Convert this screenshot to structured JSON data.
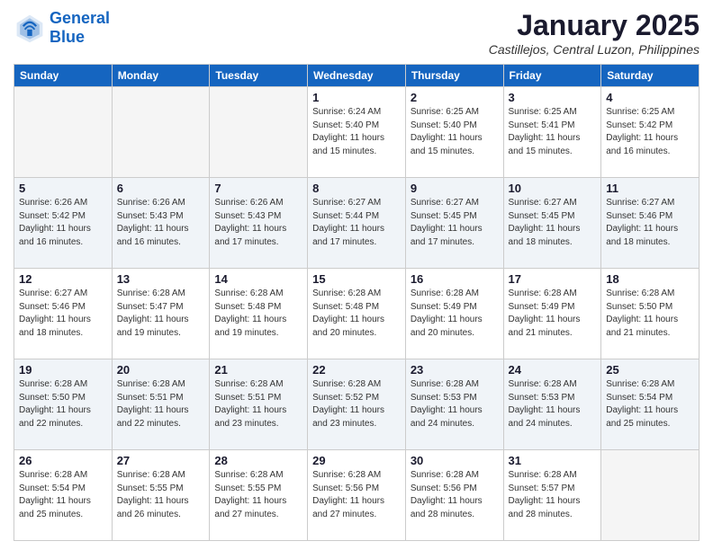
{
  "header": {
    "logo_line1": "General",
    "logo_line2": "Blue",
    "month_title": "January 2025",
    "subtitle": "Castillejos, Central Luzon, Philippines"
  },
  "days_of_week": [
    "Sunday",
    "Monday",
    "Tuesday",
    "Wednesday",
    "Thursday",
    "Friday",
    "Saturday"
  ],
  "weeks": [
    [
      {
        "day": "",
        "info": ""
      },
      {
        "day": "",
        "info": ""
      },
      {
        "day": "",
        "info": ""
      },
      {
        "day": "1",
        "info": "Sunrise: 6:24 AM\nSunset: 5:40 PM\nDaylight: 11 hours\nand 15 minutes."
      },
      {
        "day": "2",
        "info": "Sunrise: 6:25 AM\nSunset: 5:40 PM\nDaylight: 11 hours\nand 15 minutes."
      },
      {
        "day": "3",
        "info": "Sunrise: 6:25 AM\nSunset: 5:41 PM\nDaylight: 11 hours\nand 15 minutes."
      },
      {
        "day": "4",
        "info": "Sunrise: 6:25 AM\nSunset: 5:42 PM\nDaylight: 11 hours\nand 16 minutes."
      }
    ],
    [
      {
        "day": "5",
        "info": "Sunrise: 6:26 AM\nSunset: 5:42 PM\nDaylight: 11 hours\nand 16 minutes."
      },
      {
        "day": "6",
        "info": "Sunrise: 6:26 AM\nSunset: 5:43 PM\nDaylight: 11 hours\nand 16 minutes."
      },
      {
        "day": "7",
        "info": "Sunrise: 6:26 AM\nSunset: 5:43 PM\nDaylight: 11 hours\nand 17 minutes."
      },
      {
        "day": "8",
        "info": "Sunrise: 6:27 AM\nSunset: 5:44 PM\nDaylight: 11 hours\nand 17 minutes."
      },
      {
        "day": "9",
        "info": "Sunrise: 6:27 AM\nSunset: 5:45 PM\nDaylight: 11 hours\nand 17 minutes."
      },
      {
        "day": "10",
        "info": "Sunrise: 6:27 AM\nSunset: 5:45 PM\nDaylight: 11 hours\nand 18 minutes."
      },
      {
        "day": "11",
        "info": "Sunrise: 6:27 AM\nSunset: 5:46 PM\nDaylight: 11 hours\nand 18 minutes."
      }
    ],
    [
      {
        "day": "12",
        "info": "Sunrise: 6:27 AM\nSunset: 5:46 PM\nDaylight: 11 hours\nand 18 minutes."
      },
      {
        "day": "13",
        "info": "Sunrise: 6:28 AM\nSunset: 5:47 PM\nDaylight: 11 hours\nand 19 minutes."
      },
      {
        "day": "14",
        "info": "Sunrise: 6:28 AM\nSunset: 5:48 PM\nDaylight: 11 hours\nand 19 minutes."
      },
      {
        "day": "15",
        "info": "Sunrise: 6:28 AM\nSunset: 5:48 PM\nDaylight: 11 hours\nand 20 minutes."
      },
      {
        "day": "16",
        "info": "Sunrise: 6:28 AM\nSunset: 5:49 PM\nDaylight: 11 hours\nand 20 minutes."
      },
      {
        "day": "17",
        "info": "Sunrise: 6:28 AM\nSunset: 5:49 PM\nDaylight: 11 hours\nand 21 minutes."
      },
      {
        "day": "18",
        "info": "Sunrise: 6:28 AM\nSunset: 5:50 PM\nDaylight: 11 hours\nand 21 minutes."
      }
    ],
    [
      {
        "day": "19",
        "info": "Sunrise: 6:28 AM\nSunset: 5:50 PM\nDaylight: 11 hours\nand 22 minutes."
      },
      {
        "day": "20",
        "info": "Sunrise: 6:28 AM\nSunset: 5:51 PM\nDaylight: 11 hours\nand 22 minutes."
      },
      {
        "day": "21",
        "info": "Sunrise: 6:28 AM\nSunset: 5:51 PM\nDaylight: 11 hours\nand 23 minutes."
      },
      {
        "day": "22",
        "info": "Sunrise: 6:28 AM\nSunset: 5:52 PM\nDaylight: 11 hours\nand 23 minutes."
      },
      {
        "day": "23",
        "info": "Sunrise: 6:28 AM\nSunset: 5:53 PM\nDaylight: 11 hours\nand 24 minutes."
      },
      {
        "day": "24",
        "info": "Sunrise: 6:28 AM\nSunset: 5:53 PM\nDaylight: 11 hours\nand 24 minutes."
      },
      {
        "day": "25",
        "info": "Sunrise: 6:28 AM\nSunset: 5:54 PM\nDaylight: 11 hours\nand 25 minutes."
      }
    ],
    [
      {
        "day": "26",
        "info": "Sunrise: 6:28 AM\nSunset: 5:54 PM\nDaylight: 11 hours\nand 25 minutes."
      },
      {
        "day": "27",
        "info": "Sunrise: 6:28 AM\nSunset: 5:55 PM\nDaylight: 11 hours\nand 26 minutes."
      },
      {
        "day": "28",
        "info": "Sunrise: 6:28 AM\nSunset: 5:55 PM\nDaylight: 11 hours\nand 27 minutes."
      },
      {
        "day": "29",
        "info": "Sunrise: 6:28 AM\nSunset: 5:56 PM\nDaylight: 11 hours\nand 27 minutes."
      },
      {
        "day": "30",
        "info": "Sunrise: 6:28 AM\nSunset: 5:56 PM\nDaylight: 11 hours\nand 28 minutes."
      },
      {
        "day": "31",
        "info": "Sunrise: 6:28 AM\nSunset: 5:57 PM\nDaylight: 11 hours\nand 28 minutes."
      },
      {
        "day": "",
        "info": ""
      }
    ]
  ]
}
